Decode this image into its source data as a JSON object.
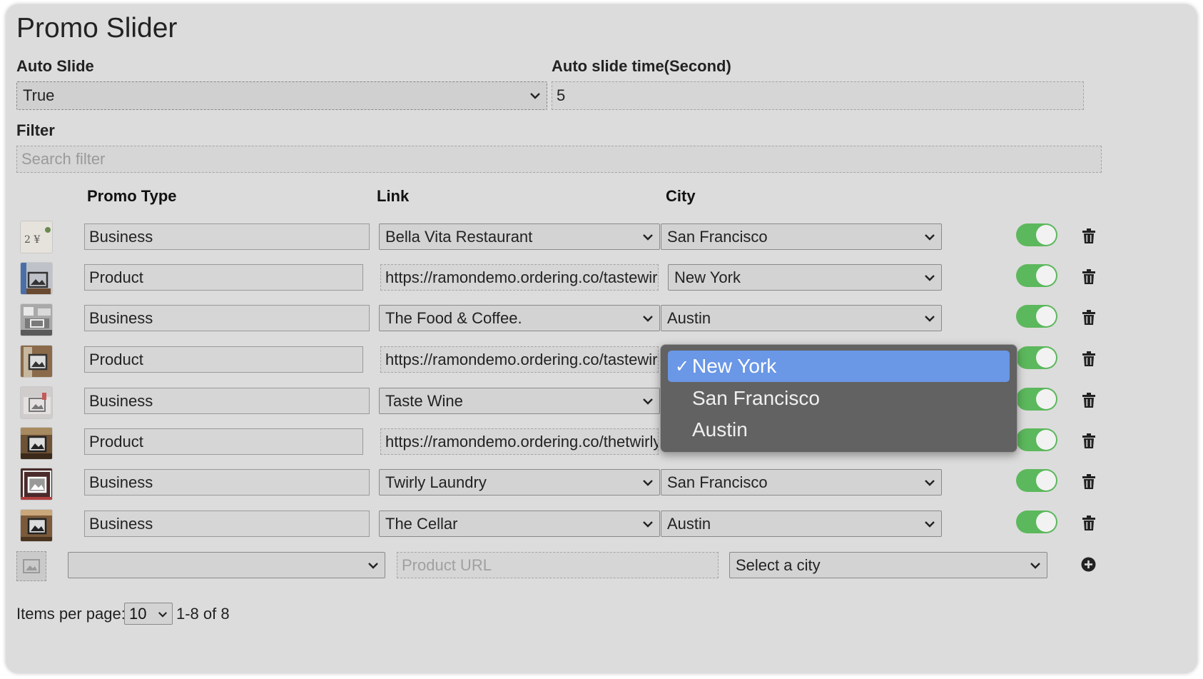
{
  "page": {
    "title": "Promo Slider"
  },
  "settings": {
    "auto_slide_label": "Auto Slide",
    "auto_slide_value": "True",
    "auto_slide_time_label": "Auto slide time(Second)",
    "auto_slide_time_value": "5",
    "filter_label": "Filter",
    "filter_placeholder": "Search filter"
  },
  "table": {
    "headers": {
      "promo_type": "Promo Type",
      "link": "Link",
      "city": "City"
    },
    "rows": [
      {
        "promo_type": "Business",
        "link": "Bella Vita Restaurant",
        "link_kind": "select",
        "city": "San Francisco",
        "enabled": true
      },
      {
        "promo_type": "Product",
        "link": "https://ramondemo.ordering.co/tastewir",
        "link_kind": "url",
        "city": "New York",
        "enabled": true
      },
      {
        "promo_type": "Business",
        "link": "The Food & Coffee.",
        "link_kind": "select",
        "city": "Austin",
        "enabled": true
      },
      {
        "promo_type": "Product",
        "link": "https://ramondemo.ordering.co/tastewir",
        "link_kind": "url",
        "city": "",
        "enabled": true
      },
      {
        "promo_type": "Business",
        "link": "Taste Wine",
        "link_kind": "select",
        "city": "",
        "enabled": true
      },
      {
        "promo_type": "Product",
        "link": "https://ramondemo.ordering.co/thetwirly",
        "link_kind": "url",
        "city": "",
        "enabled": true
      },
      {
        "promo_type": "Business",
        "link": "Twirly Laundry",
        "link_kind": "select",
        "city": "San Francisco",
        "enabled": true
      },
      {
        "promo_type": "Business",
        "link": "The Cellar",
        "link_kind": "select",
        "city": "Austin",
        "enabled": true
      }
    ],
    "new_row": {
      "promo_type": "",
      "url_placeholder": "Product URL",
      "city_placeholder": "Select a city"
    }
  },
  "city_dropdown": {
    "options": [
      {
        "label": "New York",
        "selected": true
      },
      {
        "label": "San Francisco",
        "selected": false
      },
      {
        "label": "Austin",
        "selected": false
      }
    ],
    "check_glyph": "✓"
  },
  "pagination": {
    "items_per_page_label": "Items per page:",
    "items_per_page_value": "10",
    "range_text": "1-8 of 8"
  },
  "colors": {
    "panel_bg": "#dcdcdc",
    "toggle_on": "#5cb85c",
    "dropdown_bg": "#626262",
    "dropdown_selected": "#6a97e6"
  }
}
